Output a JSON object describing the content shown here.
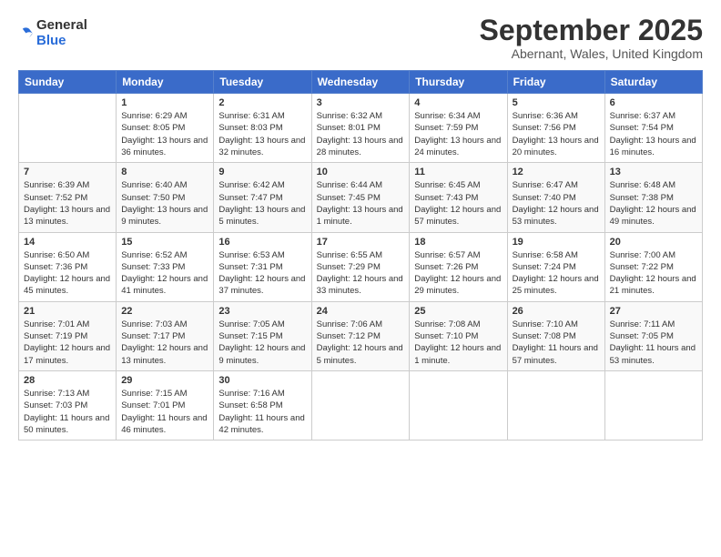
{
  "logo": {
    "general": "General",
    "blue": "Blue"
  },
  "header": {
    "month": "September 2025",
    "location": "Abernant, Wales, United Kingdom"
  },
  "weekdays": [
    "Sunday",
    "Monday",
    "Tuesday",
    "Wednesday",
    "Thursday",
    "Friday",
    "Saturday"
  ],
  "weeks": [
    [
      {
        "day": "",
        "sunrise": "",
        "sunset": "",
        "daylight": ""
      },
      {
        "day": "1",
        "sunrise": "Sunrise: 6:29 AM",
        "sunset": "Sunset: 8:05 PM",
        "daylight": "Daylight: 13 hours and 36 minutes."
      },
      {
        "day": "2",
        "sunrise": "Sunrise: 6:31 AM",
        "sunset": "Sunset: 8:03 PM",
        "daylight": "Daylight: 13 hours and 32 minutes."
      },
      {
        "day": "3",
        "sunrise": "Sunrise: 6:32 AM",
        "sunset": "Sunset: 8:01 PM",
        "daylight": "Daylight: 13 hours and 28 minutes."
      },
      {
        "day": "4",
        "sunrise": "Sunrise: 6:34 AM",
        "sunset": "Sunset: 7:59 PM",
        "daylight": "Daylight: 13 hours and 24 minutes."
      },
      {
        "day": "5",
        "sunrise": "Sunrise: 6:36 AM",
        "sunset": "Sunset: 7:56 PM",
        "daylight": "Daylight: 13 hours and 20 minutes."
      },
      {
        "day": "6",
        "sunrise": "Sunrise: 6:37 AM",
        "sunset": "Sunset: 7:54 PM",
        "daylight": "Daylight: 13 hours and 16 minutes."
      }
    ],
    [
      {
        "day": "7",
        "sunrise": "Sunrise: 6:39 AM",
        "sunset": "Sunset: 7:52 PM",
        "daylight": "Daylight: 13 hours and 13 minutes."
      },
      {
        "day": "8",
        "sunrise": "Sunrise: 6:40 AM",
        "sunset": "Sunset: 7:50 PM",
        "daylight": "Daylight: 13 hours and 9 minutes."
      },
      {
        "day": "9",
        "sunrise": "Sunrise: 6:42 AM",
        "sunset": "Sunset: 7:47 PM",
        "daylight": "Daylight: 13 hours and 5 minutes."
      },
      {
        "day": "10",
        "sunrise": "Sunrise: 6:44 AM",
        "sunset": "Sunset: 7:45 PM",
        "daylight": "Daylight: 13 hours and 1 minute."
      },
      {
        "day": "11",
        "sunrise": "Sunrise: 6:45 AM",
        "sunset": "Sunset: 7:43 PM",
        "daylight": "Daylight: 12 hours and 57 minutes."
      },
      {
        "day": "12",
        "sunrise": "Sunrise: 6:47 AM",
        "sunset": "Sunset: 7:40 PM",
        "daylight": "Daylight: 12 hours and 53 minutes."
      },
      {
        "day": "13",
        "sunrise": "Sunrise: 6:48 AM",
        "sunset": "Sunset: 7:38 PM",
        "daylight": "Daylight: 12 hours and 49 minutes."
      }
    ],
    [
      {
        "day": "14",
        "sunrise": "Sunrise: 6:50 AM",
        "sunset": "Sunset: 7:36 PM",
        "daylight": "Daylight: 12 hours and 45 minutes."
      },
      {
        "day": "15",
        "sunrise": "Sunrise: 6:52 AM",
        "sunset": "Sunset: 7:33 PM",
        "daylight": "Daylight: 12 hours and 41 minutes."
      },
      {
        "day": "16",
        "sunrise": "Sunrise: 6:53 AM",
        "sunset": "Sunset: 7:31 PM",
        "daylight": "Daylight: 12 hours and 37 minutes."
      },
      {
        "day": "17",
        "sunrise": "Sunrise: 6:55 AM",
        "sunset": "Sunset: 7:29 PM",
        "daylight": "Daylight: 12 hours and 33 minutes."
      },
      {
        "day": "18",
        "sunrise": "Sunrise: 6:57 AM",
        "sunset": "Sunset: 7:26 PM",
        "daylight": "Daylight: 12 hours and 29 minutes."
      },
      {
        "day": "19",
        "sunrise": "Sunrise: 6:58 AM",
        "sunset": "Sunset: 7:24 PM",
        "daylight": "Daylight: 12 hours and 25 minutes."
      },
      {
        "day": "20",
        "sunrise": "Sunrise: 7:00 AM",
        "sunset": "Sunset: 7:22 PM",
        "daylight": "Daylight: 12 hours and 21 minutes."
      }
    ],
    [
      {
        "day": "21",
        "sunrise": "Sunrise: 7:01 AM",
        "sunset": "Sunset: 7:19 PM",
        "daylight": "Daylight: 12 hours and 17 minutes."
      },
      {
        "day": "22",
        "sunrise": "Sunrise: 7:03 AM",
        "sunset": "Sunset: 7:17 PM",
        "daylight": "Daylight: 12 hours and 13 minutes."
      },
      {
        "day": "23",
        "sunrise": "Sunrise: 7:05 AM",
        "sunset": "Sunset: 7:15 PM",
        "daylight": "Daylight: 12 hours and 9 minutes."
      },
      {
        "day": "24",
        "sunrise": "Sunrise: 7:06 AM",
        "sunset": "Sunset: 7:12 PM",
        "daylight": "Daylight: 12 hours and 5 minutes."
      },
      {
        "day": "25",
        "sunrise": "Sunrise: 7:08 AM",
        "sunset": "Sunset: 7:10 PM",
        "daylight": "Daylight: 12 hours and 1 minute."
      },
      {
        "day": "26",
        "sunrise": "Sunrise: 7:10 AM",
        "sunset": "Sunset: 7:08 PM",
        "daylight": "Daylight: 11 hours and 57 minutes."
      },
      {
        "day": "27",
        "sunrise": "Sunrise: 7:11 AM",
        "sunset": "Sunset: 7:05 PM",
        "daylight": "Daylight: 11 hours and 53 minutes."
      }
    ],
    [
      {
        "day": "28",
        "sunrise": "Sunrise: 7:13 AM",
        "sunset": "Sunset: 7:03 PM",
        "daylight": "Daylight: 11 hours and 50 minutes."
      },
      {
        "day": "29",
        "sunrise": "Sunrise: 7:15 AM",
        "sunset": "Sunset: 7:01 PM",
        "daylight": "Daylight: 11 hours and 46 minutes."
      },
      {
        "day": "30",
        "sunrise": "Sunrise: 7:16 AM",
        "sunset": "Sunset: 6:58 PM",
        "daylight": "Daylight: 11 hours and 42 minutes."
      },
      {
        "day": "",
        "sunrise": "",
        "sunset": "",
        "daylight": ""
      },
      {
        "day": "",
        "sunrise": "",
        "sunset": "",
        "daylight": ""
      },
      {
        "day": "",
        "sunrise": "",
        "sunset": "",
        "daylight": ""
      },
      {
        "day": "",
        "sunrise": "",
        "sunset": "",
        "daylight": ""
      }
    ]
  ]
}
